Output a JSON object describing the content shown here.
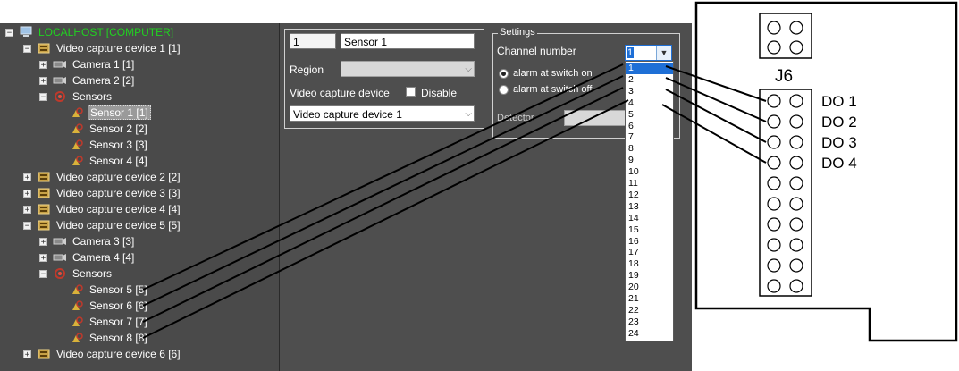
{
  "tree": {
    "root": "LOCALHOST [COMPUTER]",
    "vcd1": "Video capture device 1 [1]",
    "cam1": "Camera 1 [1]",
    "cam2": "Camera 2 [2]",
    "sensors1": "Sensors",
    "s1": "Sensor 1 [1]",
    "s2": "Sensor 2 [2]",
    "s3": "Sensor 3 [3]",
    "s4": "Sensor 4 [4]",
    "vcd2": "Video capture device 2 [2]",
    "vcd3": "Video capture device 3 [3]",
    "vcd4": "Video capture device 4 [4]",
    "vcd5": "Video capture device 5 [5]",
    "cam3": "Camera 3 [3]",
    "cam4": "Camera 4 [4]",
    "sensors2": "Sensors",
    "s5": "Sensor 5 [5]",
    "s6": "Sensor 6 [6]",
    "s7": "Sensor 7 [7]",
    "s8": "Sensor 8 [8]",
    "vcd6": "Video capture device 6 [6]"
  },
  "form": {
    "id_value": "1",
    "name_value": "Sensor 1",
    "region_label": "Region",
    "vcd_label": "Video capture device",
    "disable_label": "Disable",
    "vcd_value": "Video capture device 1"
  },
  "settings": {
    "group_title": "Settings",
    "channel_label": "Channel number",
    "channel_value": "1",
    "opt_on": "alarm at switch on",
    "opt_off": "alarm at switch off",
    "detector_label": "Detector",
    "channels": [
      "1",
      "2",
      "3",
      "4",
      "5",
      "6",
      "7",
      "8",
      "9",
      "10",
      "11",
      "12",
      "13",
      "14",
      "15",
      "16",
      "17",
      "18",
      "19",
      "20",
      "21",
      "22",
      "23",
      "24"
    ]
  },
  "board": {
    "connector": "J6",
    "outputs": [
      "DO 1",
      "DO 2",
      "DO 3",
      "DO 4"
    ]
  },
  "colors": {
    "tree_bg": "#4a4a4a",
    "root_text": "#21d121",
    "highlight": "#1e6fd6"
  }
}
